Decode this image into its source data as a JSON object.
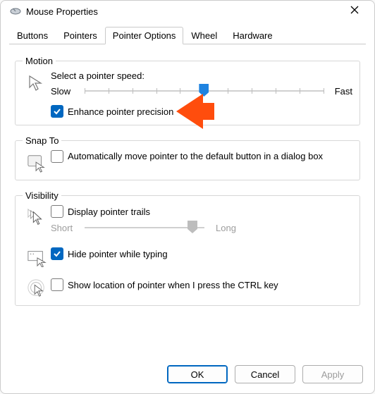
{
  "title": "Mouse Properties",
  "tabs": [
    "Buttons",
    "Pointers",
    "Pointer Options",
    "Wheel",
    "Hardware"
  ],
  "active_tab_index": 2,
  "motion": {
    "legend": "Motion",
    "prompt": "Select a pointer speed:",
    "slow": "Slow",
    "fast": "Fast",
    "speed_value": 5,
    "enhance_label": "Enhance pointer precision",
    "enhance_checked": true
  },
  "snapto": {
    "legend": "Snap To",
    "auto_label": "Automatically move pointer to the default button in a dialog box",
    "auto_checked": false
  },
  "visibility": {
    "legend": "Visibility",
    "trails_label": "Display pointer trails",
    "trails_checked": false,
    "short": "Short",
    "long": "Long",
    "hide_label": "Hide pointer while typing",
    "hide_checked": true,
    "ctrl_label": "Show location of pointer when I press the CTRL key",
    "ctrl_checked": false
  },
  "buttons": {
    "ok": "OK",
    "cancel": "Cancel",
    "apply": "Apply"
  },
  "colors": {
    "accent": "#0067c0",
    "marker": "#ff4d0d"
  }
}
